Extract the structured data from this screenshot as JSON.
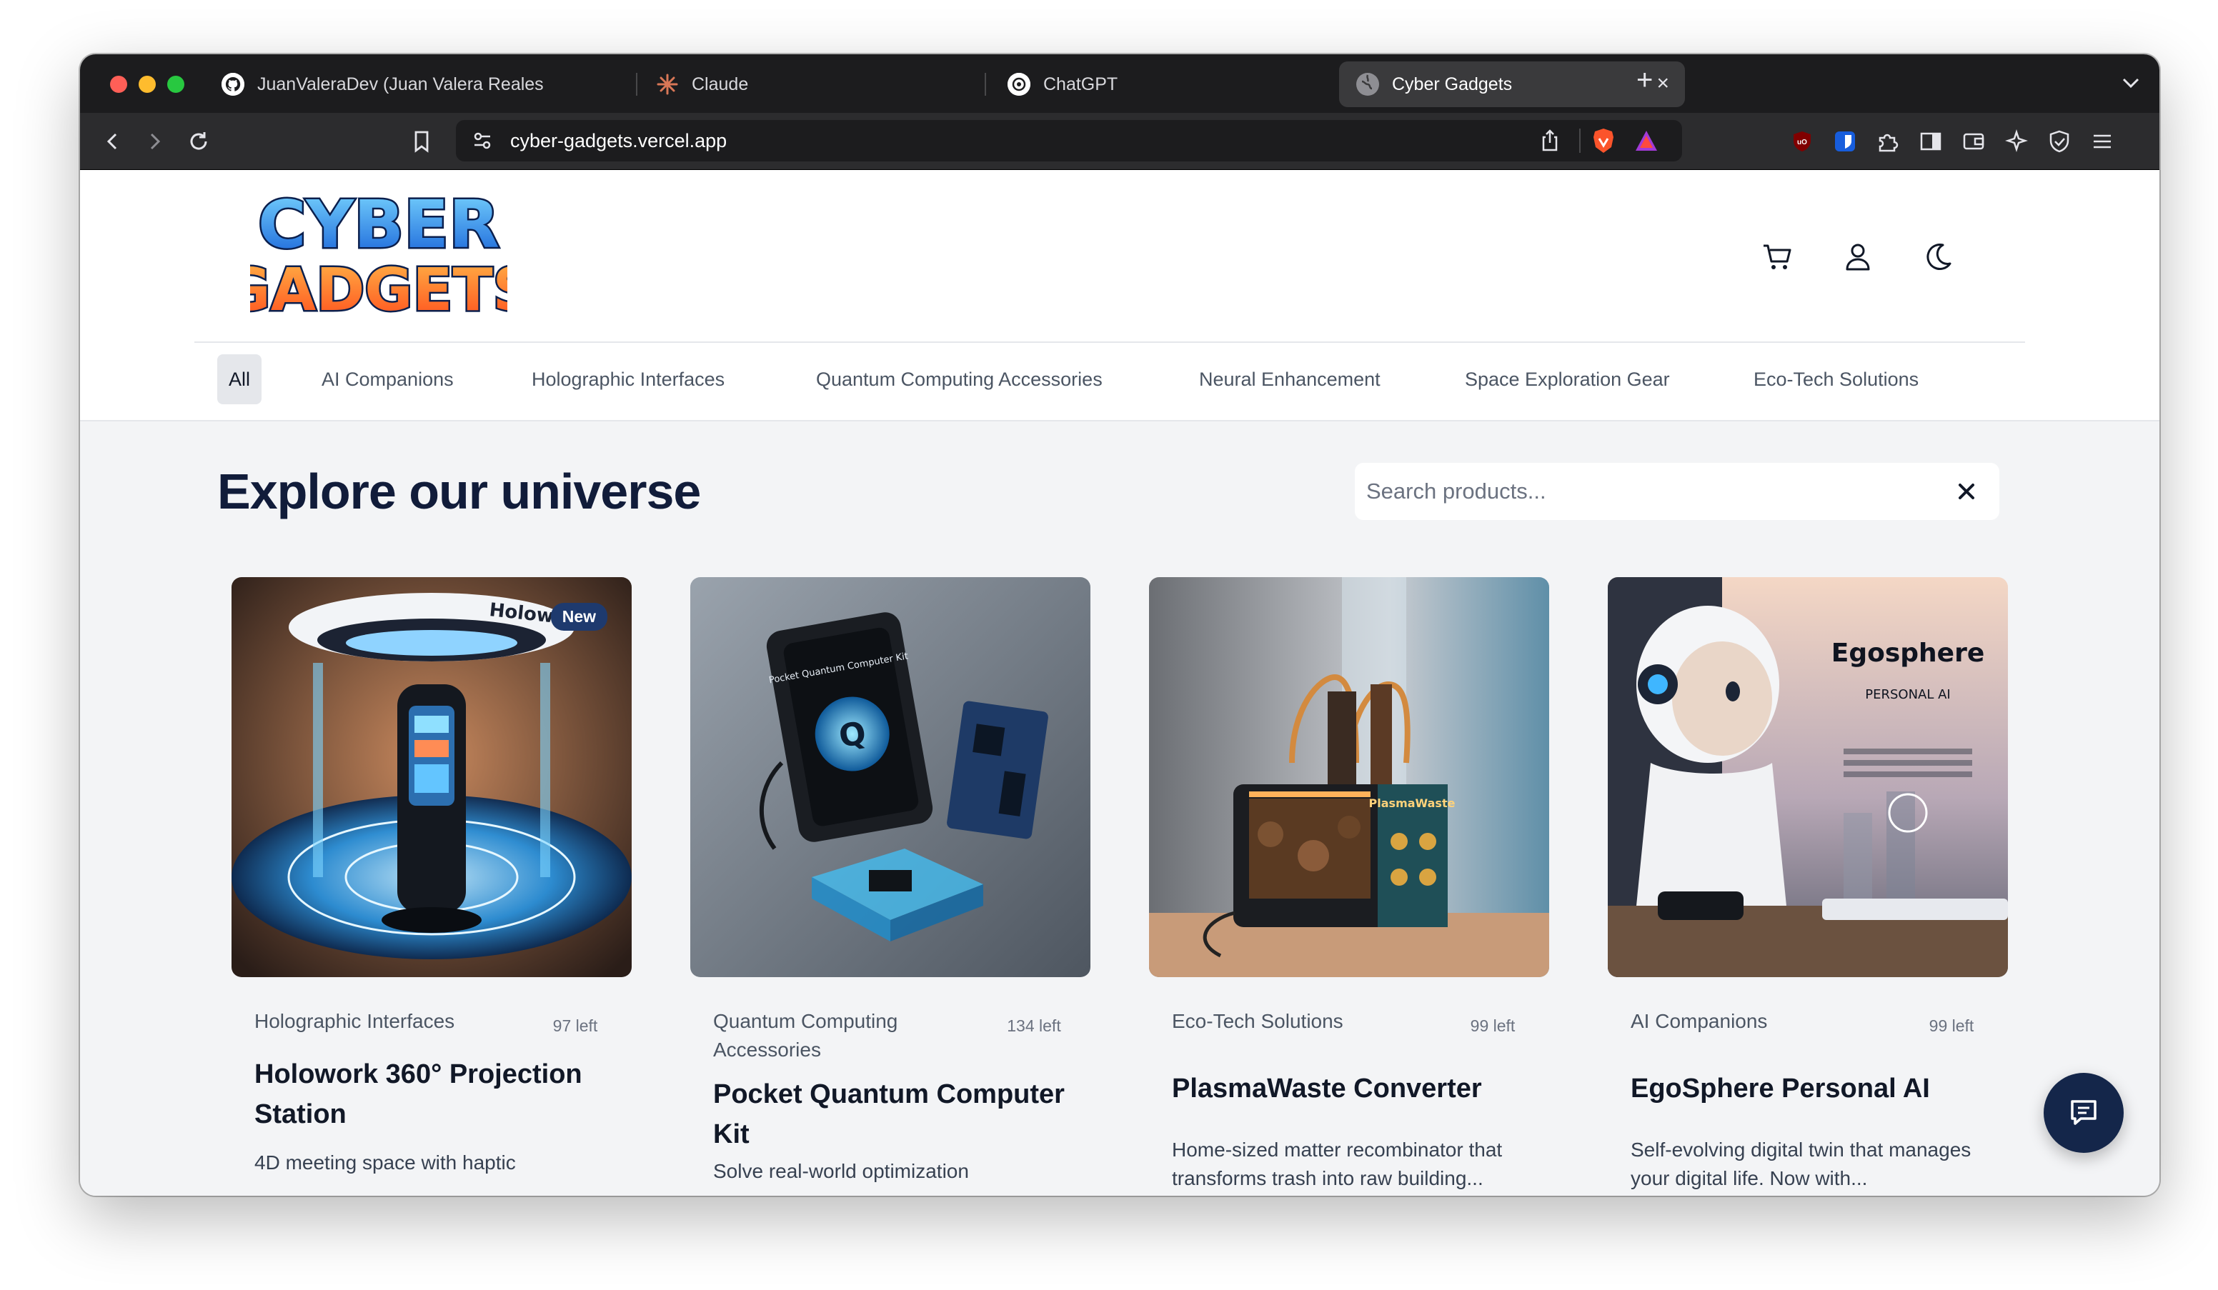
{
  "browser": {
    "tabs": [
      {
        "label": "JuanValeraDev (Juan Valera Reales)",
        "icon": "github-icon"
      },
      {
        "label": "Claude",
        "icon": "claude-icon"
      },
      {
        "label": "ChatGPT",
        "icon": "chatgpt-icon"
      },
      {
        "label": "Cyber Gadgets",
        "icon": "globe-icon",
        "active": true
      }
    ],
    "url": "cyber-gadgets.vercel.app"
  },
  "site": {
    "logo_line1": "CYBER",
    "logo_line2": "GADGETS",
    "nav": [
      {
        "label": "All",
        "active": true
      },
      {
        "label": "AI Companions"
      },
      {
        "label": "Holographic Interfaces"
      },
      {
        "label": "Quantum Computing Accessories"
      },
      {
        "label": "Neural Enhancement"
      },
      {
        "label": "Space Exploration Gear"
      },
      {
        "label": "Eco-Tech Solutions"
      }
    ],
    "header_icons": [
      "cart-icon",
      "user-icon",
      "moon-icon"
    ]
  },
  "main": {
    "title": "Explore our universe",
    "search_placeholder": "Search products...",
    "products": [
      {
        "category": "Holographic Interfaces",
        "stock": "97 left",
        "name": "Holowork 360° Projection Station",
        "description": "4D meeting space with haptic",
        "badge": "New",
        "image_text": "Holowork"
      },
      {
        "category": "Quantum Computing Accessories",
        "stock": "134 left",
        "name": "Pocket Quantum Computer Kit",
        "description": "Solve real-world optimization",
        "image_text": "Pocket Quantum Computer Kit"
      },
      {
        "category": "Eco-Tech Solutions",
        "stock": "99 left",
        "name": "PlasmaWaste Converter",
        "description": "Home-sized matter recombinator that transforms trash into raw building...",
        "image_text": "PlasmaWaste"
      },
      {
        "category": "AI Companions",
        "stock": "99 left",
        "name": "EgoSphere Personal AI",
        "description": "Self-evolving digital twin that manages your digital life. Now with...",
        "image_text": "Egosphere",
        "image_subtext": "PERSONAL AI"
      }
    ]
  },
  "colors": {
    "accent": "#111c3a",
    "fab": "#14264a",
    "badge": "#1e3a6e"
  }
}
